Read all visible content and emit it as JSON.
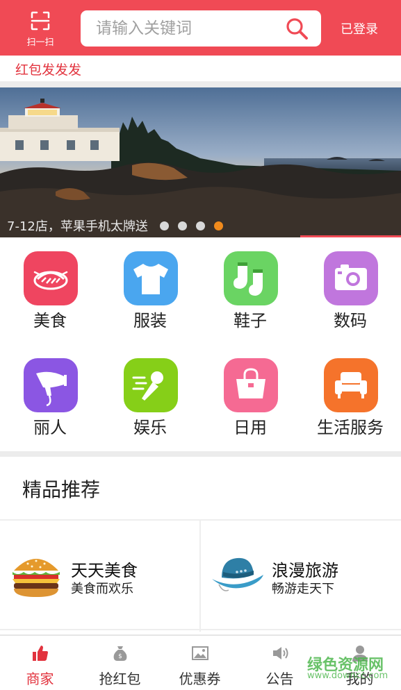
{
  "header": {
    "scan_label": "扫一扫",
    "search_placeholder": "请输入关键词",
    "login_label": "已登录"
  },
  "notice": {
    "text": "红包发发发"
  },
  "banner": {
    "caption": "7-12店，苹果手机太牌送",
    "slide_count": 4,
    "active_slide": 4
  },
  "categories": [
    {
      "label": "美食",
      "color": "#ef4560",
      "icon": "food-icon"
    },
    {
      "label": "服装",
      "color": "#4aa6ef",
      "icon": "shirt-icon"
    },
    {
      "label": "鞋子",
      "color": "#6ad463",
      "icon": "socks-icon"
    },
    {
      "label": "数码",
      "color": "#c076dd",
      "icon": "camera-icon"
    },
    {
      "label": "丽人",
      "color": "#8b56e3",
      "icon": "hairdryer-icon"
    },
    {
      "label": "娱乐",
      "color": "#86cf18",
      "icon": "microphone-icon"
    },
    {
      "label": "日用",
      "color": "#f56a93",
      "icon": "handbag-icon"
    },
    {
      "label": "生活服务",
      "color": "#f5732b",
      "icon": "sofa-icon"
    }
  ],
  "section": {
    "title": "精品推荐"
  },
  "recommendations": [
    {
      "title": "天天美食",
      "subtitle": "美食而欢乐",
      "icon": "burger-icon"
    },
    {
      "title": "浪漫旅游",
      "subtitle": "畅游走天下",
      "icon": "hat-icon"
    }
  ],
  "tabs": [
    {
      "label": "商家",
      "icon": "thumbs-up-icon",
      "active": true
    },
    {
      "label": "抢红包",
      "icon": "money-bag-icon",
      "active": false
    },
    {
      "label": "优惠券",
      "icon": "coupon-icon",
      "active": false
    },
    {
      "label": "公告",
      "icon": "speaker-icon",
      "active": false
    },
    {
      "label": "我的",
      "icon": "user-icon",
      "active": false
    }
  ],
  "watermark": {
    "text": "绿色资源网",
    "url": "www.downcc.com"
  },
  "colors": {
    "brand": "#f04a55",
    "active_dot": "#f08a1c",
    "active_tab": "#e2333e"
  }
}
